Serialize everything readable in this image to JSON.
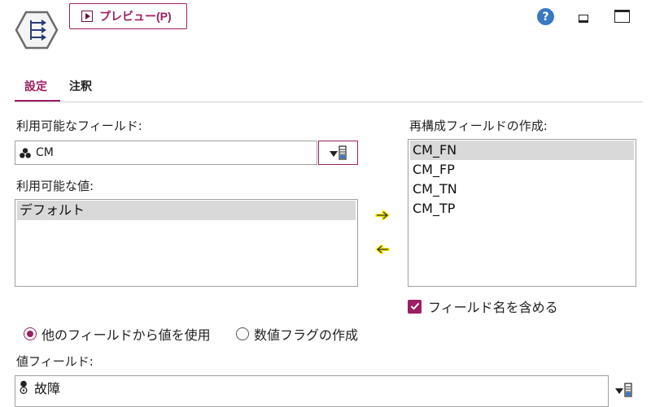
{
  "header": {
    "node_icon": "restructure-node-icon",
    "preview_label": "プレビュー(P)",
    "help_glyph": "?"
  },
  "tabs": [
    {
      "label": "設定",
      "active": true
    },
    {
      "label": "注釈",
      "active": false
    }
  ],
  "available_fields": {
    "label": "利用可能なフィールド:",
    "value": "CM",
    "icon": "nominal-field-icon"
  },
  "available_values": {
    "label": "利用可能な値:",
    "items": [
      {
        "text": "デフォルト",
        "selected": true
      }
    ]
  },
  "generated_fields": {
    "label": "再構成フィールドの作成:",
    "items": [
      {
        "text": "CM_FN",
        "selected": true
      },
      {
        "text": "CM_FP",
        "selected": false
      },
      {
        "text": "CM_TN",
        "selected": false
      },
      {
        "text": "CM_TP",
        "selected": false
      }
    ]
  },
  "include_field_name": {
    "label": "フィールド名を含める",
    "checked": true
  },
  "mode": {
    "options": [
      {
        "label": "他のフィールドから値を使用",
        "selected": true
      },
      {
        "label": "数値フラグの作成",
        "selected": false
      }
    ]
  },
  "value_field": {
    "label": "値フィールド:",
    "value": "故障",
    "icon": "flag-field-icon"
  },
  "colors": {
    "accent": "#9c1e64",
    "help": "#3a78c3",
    "selection": "#d9d9d9",
    "arrow_highlight": "#f5e800"
  }
}
